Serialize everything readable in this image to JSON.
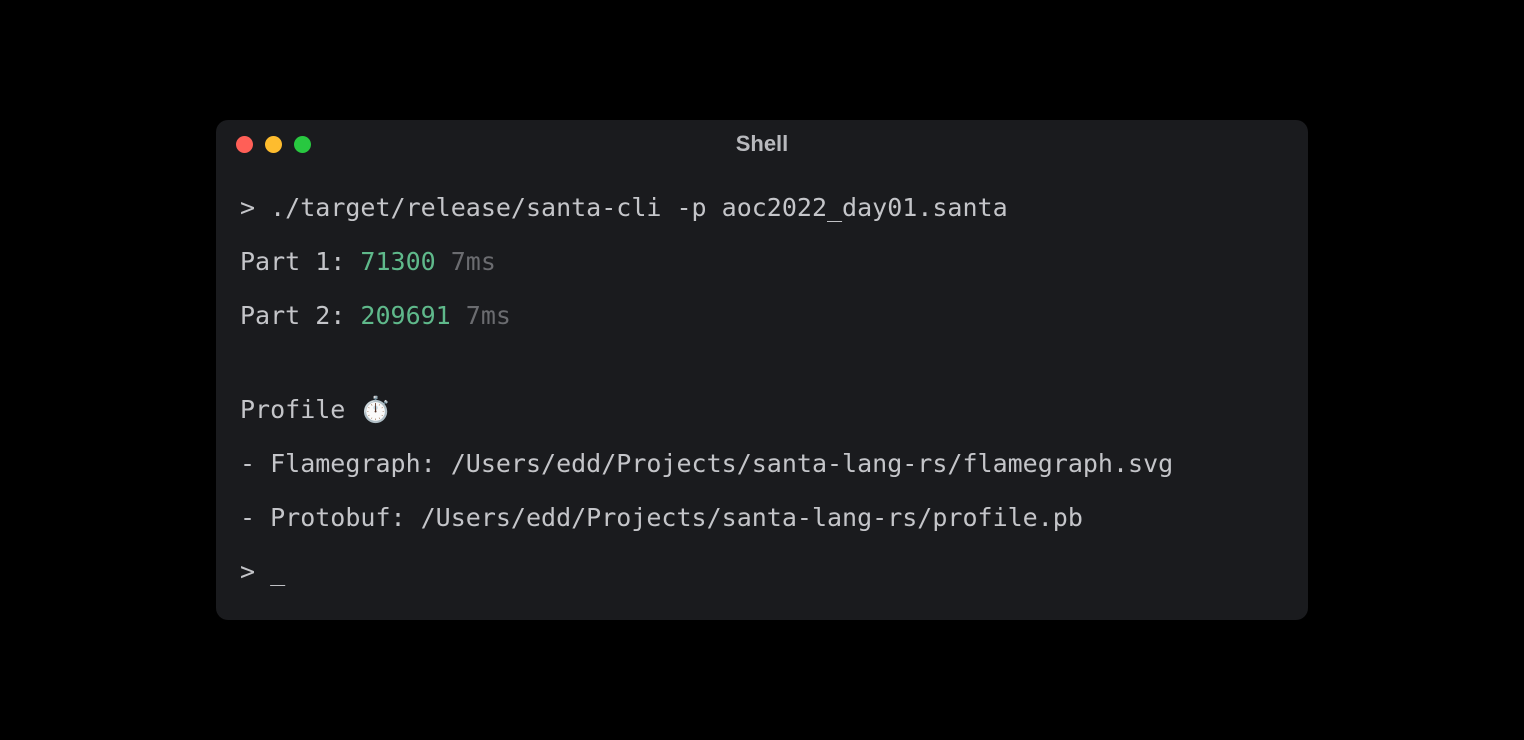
{
  "window": {
    "title": "Shell"
  },
  "terminal": {
    "prompt1": "> ",
    "command": "./target/release/santa-cli -p aoc2022_day01.santa",
    "part1": {
      "label": "Part 1: ",
      "value": "71300",
      "time": " 7ms"
    },
    "part2": {
      "label": "Part 2: ",
      "value": "209691",
      "time": " 7ms"
    },
    "profile_header": "Profile ⏱️",
    "flamegraph_line": "- Flamegraph: /Users/edd/Projects/santa-lang-rs/flamegraph.svg",
    "protobuf_line": "- Protobuf: /Users/edd/Projects/santa-lang-rs/profile.pb",
    "prompt2": "> ",
    "cursor": "_"
  }
}
